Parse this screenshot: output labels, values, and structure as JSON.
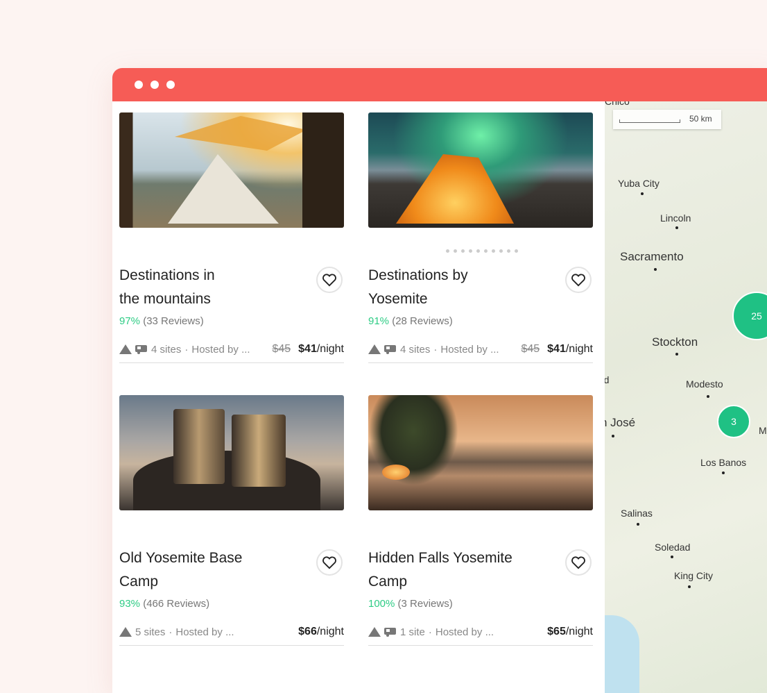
{
  "window": {
    "controls": [
      "close",
      "minimize",
      "maximize"
    ]
  },
  "listings": [
    {
      "title_line1": "Destinations in",
      "title_line2": "the mountains",
      "rating": "97%",
      "reviews": "(33 Reviews)",
      "sites": "4 sites",
      "host": "Hosted by ...",
      "old_price": "$45",
      "price": "$41",
      "per": "/night",
      "icons": [
        "tent-icon",
        "rv-icon"
      ]
    },
    {
      "title_line1": "Destinations by",
      "title_line2": "Yosemite",
      "rating": "91%",
      "reviews": "(28 Reviews)",
      "sites": "4 sites",
      "host": "Hosted by ...",
      "old_price": "$45",
      "price": "$41",
      "per": "/night",
      "icons": [
        "tent-icon",
        "rv-icon"
      ]
    },
    {
      "title_line1": "Old Yosemite Base",
      "title_line2": "Camp",
      "rating": "93%",
      "reviews": "(466 Reviews)",
      "sites": "5 sites",
      "host": "Hosted by ...",
      "old_price": "",
      "price": "$66",
      "per": "/night",
      "icons": [
        "tent-icon"
      ]
    },
    {
      "title_line1": "Hidden Falls Yosemite",
      "title_line2": "Camp",
      "rating": "100%",
      "reviews": "(3 Reviews)",
      "sites": "1 site",
      "host": "Hosted by ...",
      "old_price": "",
      "price": "$65",
      "per": "/night",
      "icons": [
        "tent-icon",
        "rv-icon"
      ]
    }
  ],
  "map": {
    "scale": "50 km",
    "cities": [
      "Chico",
      "Yuba City",
      "Lincoln",
      "Sacramento",
      "Stockton",
      "rd",
      "Modesto",
      "n José",
      "Merc",
      "Los Banos",
      "Salinas",
      "Soledad",
      "King City"
    ],
    "clusters": [
      "25",
      "3"
    ]
  },
  "colors": {
    "accent": "#f65c56",
    "green": "#2ecc85",
    "cluster": "#1fc184"
  }
}
